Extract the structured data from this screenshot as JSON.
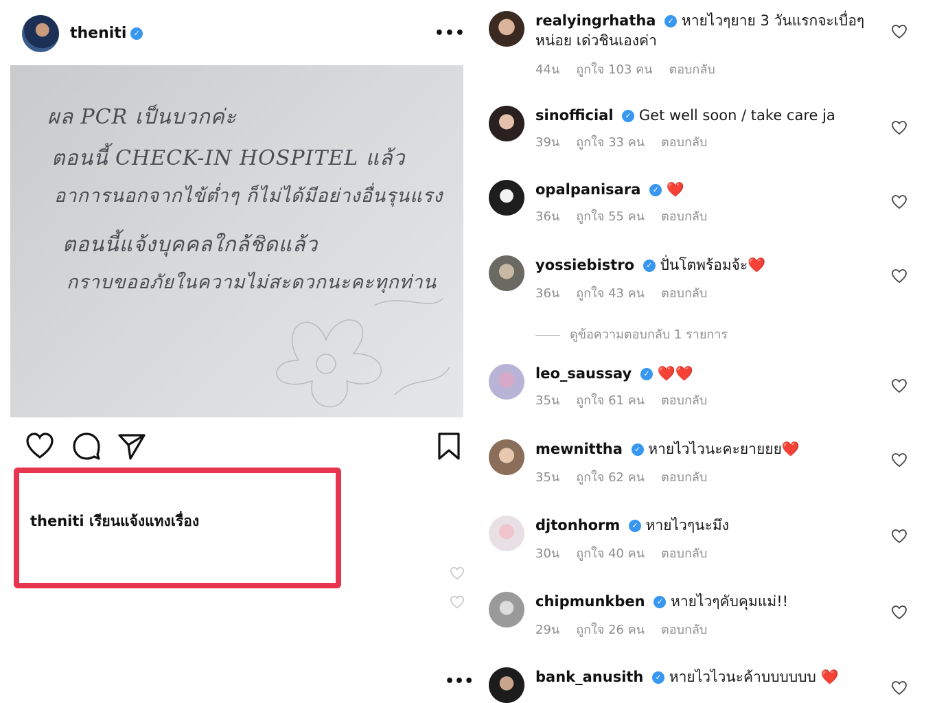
{
  "post": {
    "username": "theniti",
    "verified": "✓",
    "more": "•••",
    "photo_lines": [
      "ผล PCR เป็นบวกค่ะ",
      "ตอนนี้ CHECK-IN HOSPITEL แล้ว",
      "อาการนอกจากไข้ต่ำๆ ก็ไม่ได้มีอย่างอื่นรุนแรง",
      "ตอนนี้แจ้งบุคคลใกล้ชิดแล้ว",
      "กราบขออภัยในความไม่สะดวกนะคะทุกท่าน"
    ],
    "caption": "theniti เรียนแจ้งแทงเรื่อง",
    "highlight_color": "#e8344e"
  },
  "comments": [
    {
      "user": "realyingrhatha",
      "text": "หายไวๆยาย 3 วันแรกจะเบื่อๆ หน่อย เด่วชินเองค่า",
      "time": "44น",
      "likes": "ถูกใจ 103 คน",
      "reply": "ตอบกลับ"
    },
    {
      "user": "sinofficial",
      "text": "Get well soon / take care ja",
      "time": "39น",
      "likes": "ถูกใจ 33 คน",
      "reply": "ตอบกลับ"
    },
    {
      "user": "opalpanisara",
      "text": "❤️",
      "time": "36น",
      "likes": "ถูกใจ 55 คน",
      "reply": "ตอบกลับ"
    },
    {
      "user": "yossiebistro",
      "text": "ปั่นโตพร้อมจ้ะ❤️",
      "time": "36น",
      "likes": "ถูกใจ 43 คน",
      "reply": "ตอบกลับ"
    },
    {
      "user": "leo_saussay",
      "text": "❤️❤️",
      "time": "35น",
      "likes": "ถูกใจ 61 คน",
      "reply": "ตอบกลับ"
    },
    {
      "user": "mewnittha",
      "text": "หายไวไวนะคะยายยย❤️",
      "time": "35น",
      "likes": "ถูกใจ 62 คน",
      "reply": "ตอบกลับ"
    },
    {
      "user": "djtonhorm",
      "text": "หายไวๆนะมึง",
      "time": "30น",
      "likes": "ถูกใจ 40 คน",
      "reply": "ตอบกลับ"
    },
    {
      "user": "chipmunkben",
      "text": "หายไวๆคับคุมแม่!!",
      "time": "29น",
      "likes": "ถูกใจ 26 คน",
      "reply": "ตอบกลับ"
    },
    {
      "user": "bank_anusith",
      "text": "หายไวไวนะค้าบบบบบบ ❤️",
      "time": "",
      "likes": "",
      "reply": ""
    }
  ],
  "view_replies": "ดูข้อความตอบกลับ 1 รายการ"
}
